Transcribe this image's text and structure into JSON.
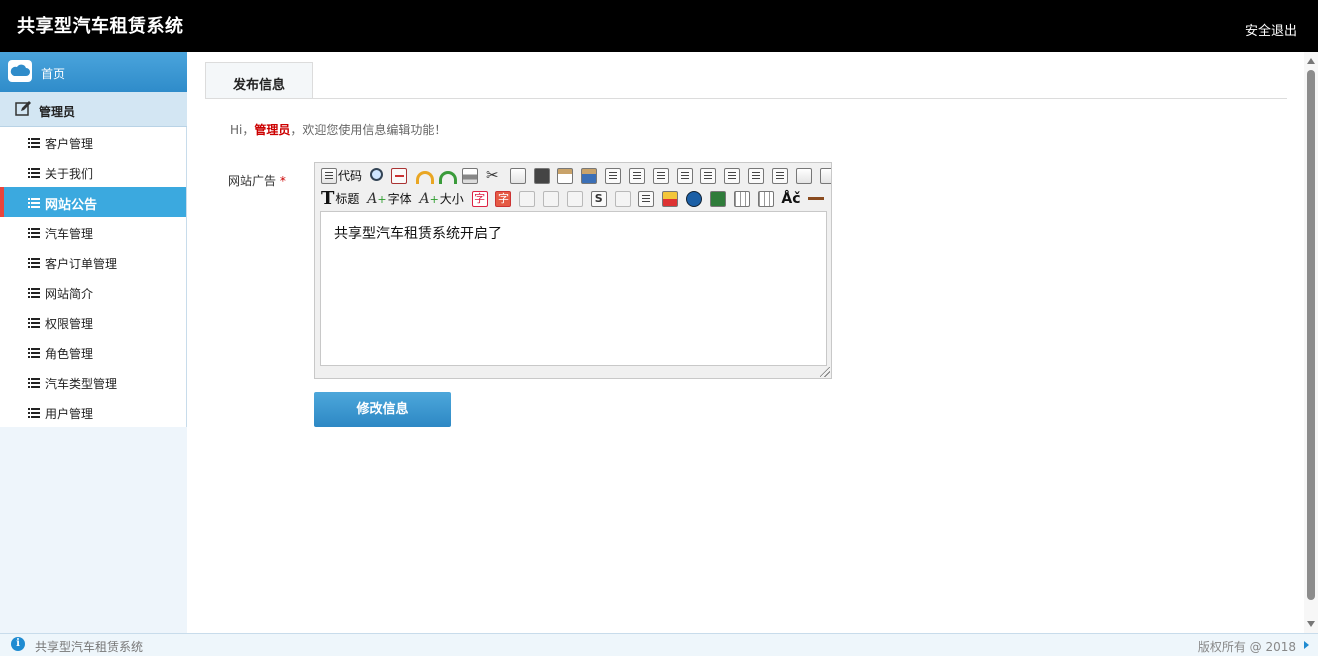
{
  "header": {
    "app_title": "共享型汽车租赁系统",
    "logout_label": "安全退出"
  },
  "sidebar": {
    "home_label": "首页",
    "group_label": "管理员",
    "items": [
      {
        "label": "客户管理",
        "active": false
      },
      {
        "label": "关于我们",
        "active": false
      },
      {
        "label": "网站公告",
        "active": true
      },
      {
        "label": "汽车管理",
        "active": false
      },
      {
        "label": "客户订单管理",
        "active": false
      },
      {
        "label": "网站简介",
        "active": false
      },
      {
        "label": "权限管理",
        "active": false
      },
      {
        "label": "角色管理",
        "active": false
      },
      {
        "label": "汽车类型管理",
        "active": false
      },
      {
        "label": "用户管理",
        "active": false
      }
    ]
  },
  "main": {
    "tab_label": "发布信息",
    "greeting_prefix": "Hi，",
    "greeting_user": "管理员",
    "greeting_suffix": "，欢迎您使用信息编辑功能！",
    "field_label": "网站广告",
    "required_mark": "*",
    "editor": {
      "toolbar": {
        "code_label": "代码",
        "title_label": "标题",
        "font_label": "字体",
        "size_label": "大小",
        "char_label": "字"
      },
      "content": "共享型汽车租赁系统开启了"
    },
    "submit_label": "修改信息"
  },
  "footer": {
    "left_text": "共享型汽车租赁系统",
    "right_text": "版权所有 @ 2018"
  },
  "colors": {
    "header_bg": "#000000",
    "accent": "#3ba9df",
    "active_marker": "#e8453c",
    "required": "#cc0000"
  }
}
